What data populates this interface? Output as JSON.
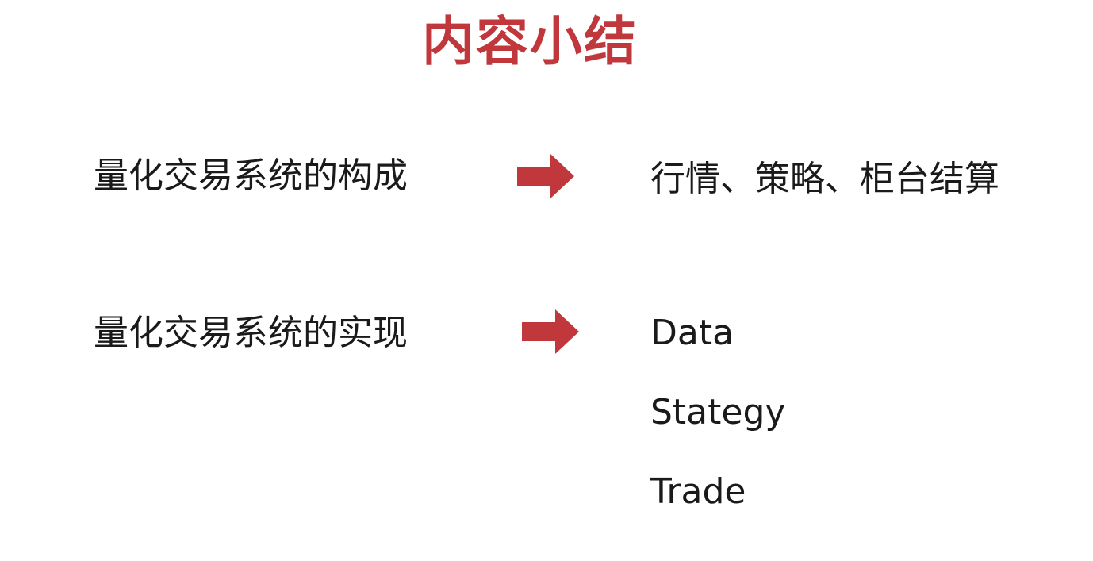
{
  "title": "内容小结",
  "colors": {
    "title": "#c0383c",
    "arrow": "#c0383c",
    "text": "#1a1a1a"
  },
  "rows": [
    {
      "label": "量化交易系统的构成",
      "value": "行情、策略、柜台结算",
      "arrow_icon": "right-arrow-icon"
    },
    {
      "label": "量化交易系统的实现",
      "arrow_icon": "right-arrow-icon",
      "items": [
        "Data",
        "Stategy",
        "Trade"
      ]
    }
  ]
}
